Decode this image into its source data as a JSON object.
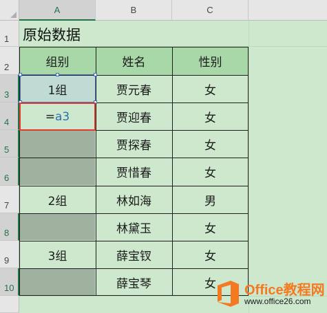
{
  "columns": [
    "A",
    "B",
    "C"
  ],
  "rows": [
    "1",
    "2",
    "3",
    "4",
    "5",
    "6",
    "7",
    "8",
    "9",
    "10"
  ],
  "title": "原始数据",
  "table": {
    "headers": [
      "组别",
      "姓名",
      "性别"
    ],
    "group_cells": [
      "1组",
      "2组",
      "3组"
    ],
    "names": [
      "贾元春",
      "贾迎春",
      "贾探春",
      "贾惜春",
      "林如海",
      "林黛玉",
      "薛宝钗",
      "薛宝琴"
    ],
    "genders": [
      "女",
      "女",
      "女",
      "女",
      "男",
      "女",
      "女",
      "女"
    ]
  },
  "active_cell": {
    "formula_eq": "=",
    "formula_ref": "a3"
  },
  "logo": {
    "name": "Office教程网",
    "url": "www.office26.com"
  },
  "colors": {
    "selection": "#4a78c4",
    "active_border": "#e03a2e",
    "header_fill": "#a8d8a8",
    "blank_fill": "#9fb29f",
    "logo_orange": "#f47920"
  }
}
